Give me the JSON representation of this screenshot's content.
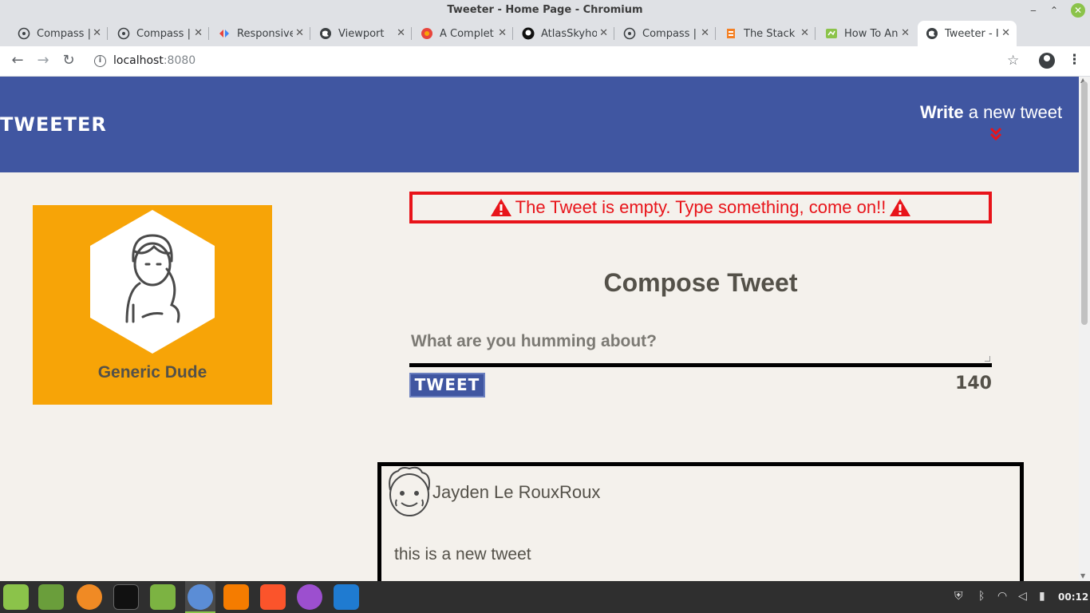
{
  "window": {
    "title": "Tweeter - Home Page - Chromium"
  },
  "tabs": [
    {
      "label": "Compass |",
      "icon": "globe-icon"
    },
    {
      "label": "Compass |",
      "icon": "globe-icon"
    },
    {
      "label": "Responsive",
      "icon": "responsive-icon"
    },
    {
      "label": "Viewport",
      "icon": "globe-icon"
    },
    {
      "label": "A Complet",
      "icon": "flower-icon"
    },
    {
      "label": "AtlasSkyho",
      "icon": "github-icon"
    },
    {
      "label": "Compass |",
      "icon": "globe-icon"
    },
    {
      "label": "The Stack",
      "icon": "stack-icon"
    },
    {
      "label": "How To An",
      "icon": "leaf-icon"
    },
    {
      "label": "Tweeter - I",
      "icon": "globe-icon",
      "active": true
    }
  ],
  "address": {
    "host": "localhost",
    "port": ":8080"
  },
  "page": {
    "brand": "TWEETER",
    "nav": {
      "write_bold": "Write",
      "write_rest": " a new tweet",
      "chevron": "»"
    },
    "profile": {
      "name": "Generic Dude"
    },
    "error": {
      "message": "The Tweet is empty. Type something, come on!!"
    },
    "compose": {
      "title": "Compose Tweet",
      "placeholder": "What are you humming about?",
      "button": "TWEET",
      "counter": "140"
    },
    "tweet": {
      "author": "Jayden Le RouxRoux",
      "body": "this is a new tweet"
    }
  },
  "taskbar": {
    "clock": "00:12"
  },
  "colors": {
    "nav": "#4056a1",
    "accent": "#e8141a",
    "profile_card": "#f7a407",
    "page_bg": "#f4f1ec"
  }
}
